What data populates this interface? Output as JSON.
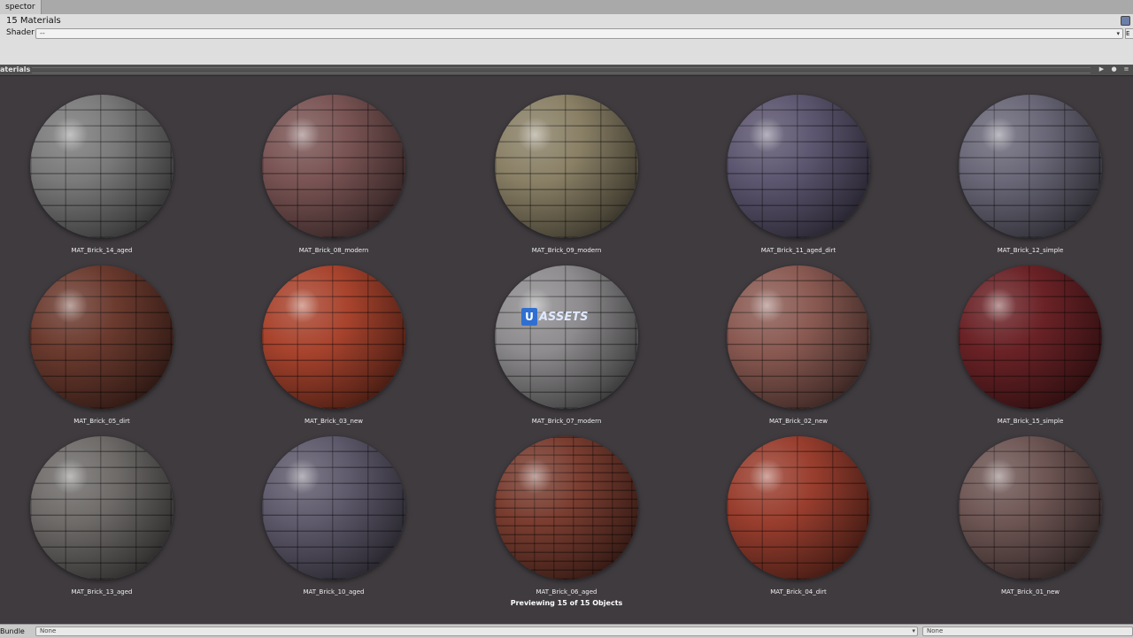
{
  "window": {
    "tab_label": "spector"
  },
  "inspector": {
    "title": "15 Materials",
    "shader_label": "Shader",
    "shader_value": "--",
    "edit_label": "E"
  },
  "preview": {
    "title": "aterials",
    "count_text": "Previewing 15 of 15 Objects"
  },
  "watermark": {
    "badge": "U",
    "text": "ASSETS"
  },
  "materials": [
    {
      "name": "MAT_Brick_14_aged",
      "color": "#7a7a7a"
    },
    {
      "name": "MAT_Brick_08_modern",
      "color": "#7a5454"
    },
    {
      "name": "MAT_Brick_09_modern",
      "color": "#8a8066"
    },
    {
      "name": "MAT_Brick_11_aged_dirt",
      "color": "#5d5670"
    },
    {
      "name": "MAT_Brick_12_simple",
      "color": "#6a6878"
    },
    {
      "name": "MAT_Brick_05_dirt",
      "color": "#6b3a2e"
    },
    {
      "name": "MAT_Brick_03_new",
      "color": "#a8432d"
    },
    {
      "name": "MAT_Brick_07_modern",
      "color": "#8e8c8e"
    },
    {
      "name": "MAT_Brick_02_new",
      "color": "#8a5a52"
    },
    {
      "name": "MAT_Brick_15_simple",
      "color": "#6a2226"
    },
    {
      "name": "MAT_Brick_13_aged",
      "color": "#6e6b69"
    },
    {
      "name": "MAT_Brick_10_aged",
      "color": "#5f5a6c"
    },
    {
      "name": "MAT_Brick_06_aged",
      "color": "#7a3d30"
    },
    {
      "name": "MAT_Brick_04_dirt",
      "color": "#993e2e"
    },
    {
      "name": "MAT_Brick_01_new",
      "color": "#6e5654"
    }
  ],
  "bottom": {
    "bundle_label": "Bundle",
    "bundle_value": "None",
    "variant_value": "None"
  }
}
